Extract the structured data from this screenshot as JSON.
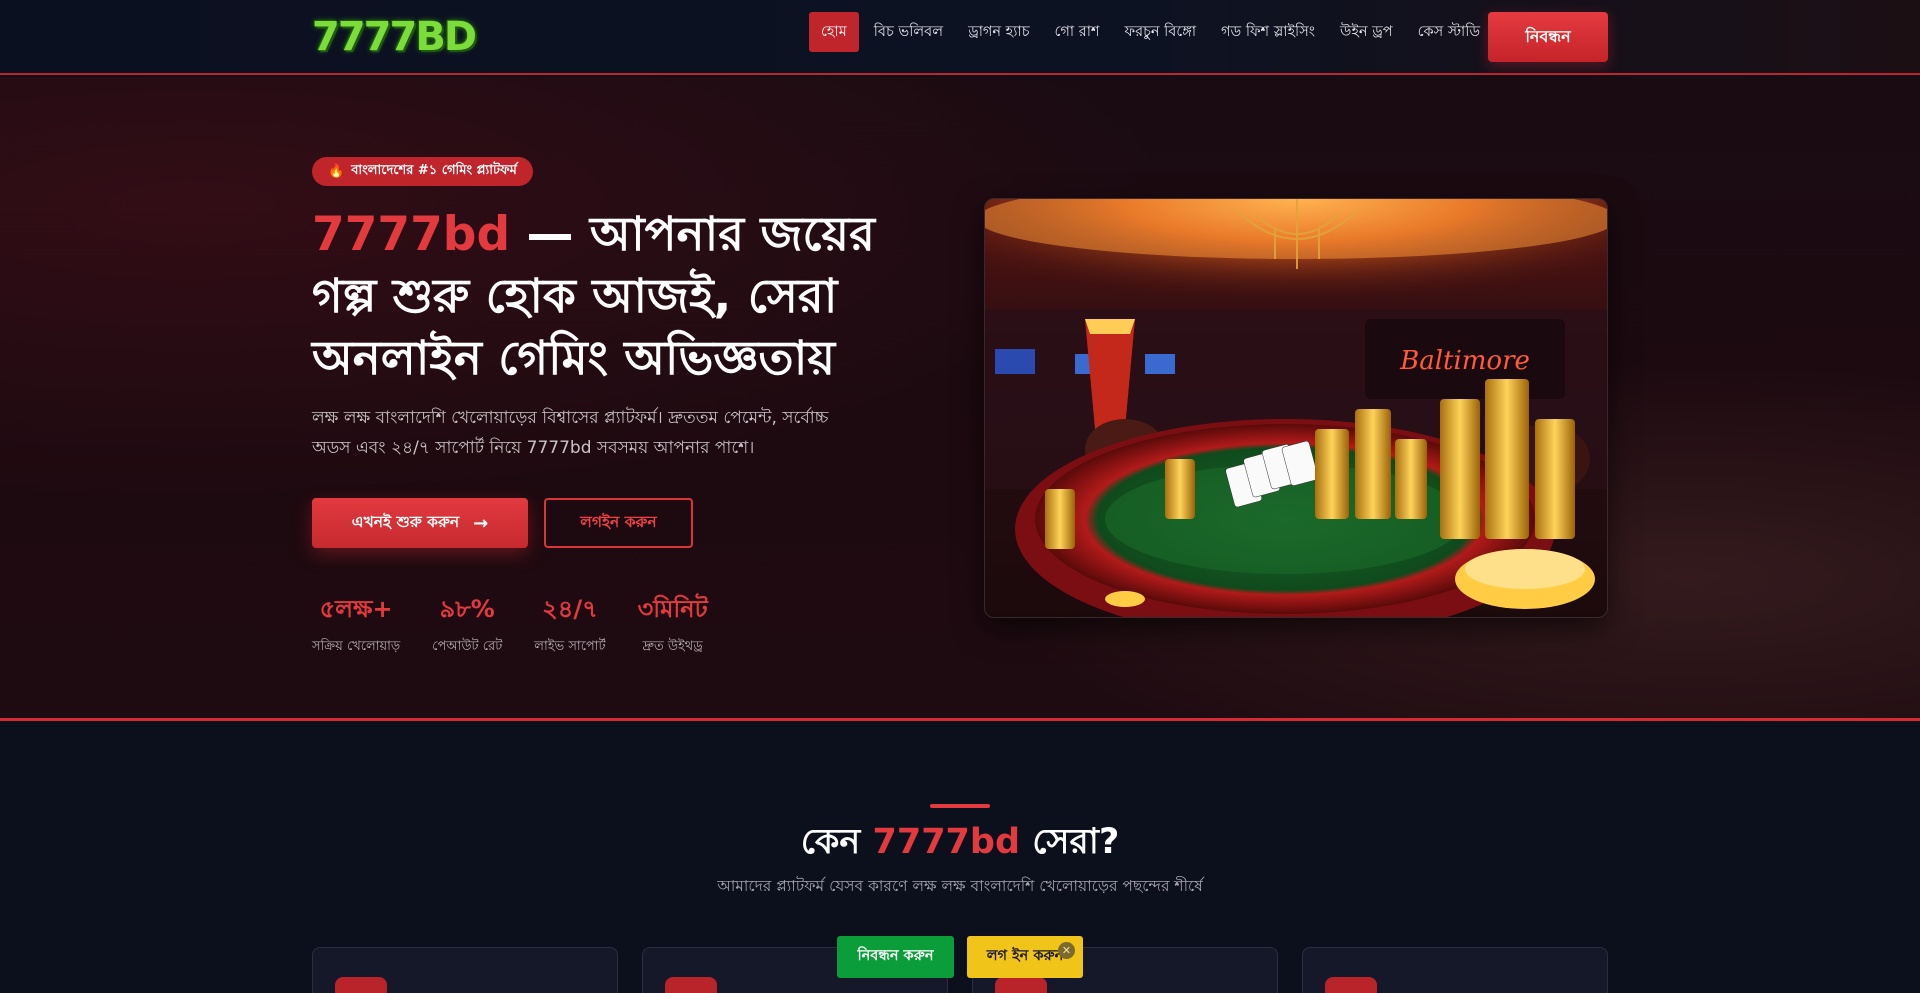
{
  "header": {
    "logo_text": "7777BD",
    "nav": [
      {
        "label": "হোম",
        "active": true
      },
      {
        "label": "বিচ ভলিবল",
        "active": false
      },
      {
        "label": "ড্রাগন হ্যাচ",
        "active": false
      },
      {
        "label": "গো রাশ",
        "active": false
      },
      {
        "label": "ফরচুন বিঙ্গো",
        "active": false
      },
      {
        "label": "গড ফিশ স্লাইসিং",
        "active": false
      },
      {
        "label": "উইন ড্রপ",
        "active": false
      },
      {
        "label": "কেস স্টাডি",
        "active": false
      }
    ],
    "register_label": "নিবন্ধন"
  },
  "hero": {
    "badge_icon": "fire-icon",
    "badge_text": "বাংলাদেশের #১ গেমিং প্ল্যাটফর্ম",
    "title_brand": "7777bd",
    "title_rest": " — আপনার জয়ের গল্প শুরু হোক আজই, সেরা অনলাইন গেমিং অভিজ্ঞতায়",
    "description": "লক্ষ লক্ষ বাংলাদেশি খেলোয়াড়ের বিশ্বাসের প্ল্যাটফর্ম। দ্রুততম পেমেন্ট, সর্বোচ্চ অডস এবং ২৪/৭ সাপোর্ট নিয়ে 7777bd সবসময় আপনার পাশে।",
    "cta_primary": "এখনই শুরু করুন",
    "cta_primary_icon": "arrow-right-icon",
    "cta_secondary": "লগইন করুন",
    "stats": [
      {
        "value": "৫লক্ষ+",
        "label": "সক্রিয় খেলোয়াড়"
      },
      {
        "value": "৯৮%",
        "label": "পেআউট রেট"
      },
      {
        "value": "২৪/৭",
        "label": "লাইভ সাপোর্ট"
      },
      {
        "value": "৩মিনিট",
        "label": "দ্রুত উইথড্র"
      }
    ],
    "image_sign_text": "Baltimore"
  },
  "why_section": {
    "title_prefix": "কেন ",
    "title_brand": "7777bd",
    "title_suffix": " সেরা?",
    "subtitle": "আমাদের প্ল্যাটফর্ম যেসব কারণে লক্ষ লক্ষ বাংলাদেশি খেলোয়াড়ের পছন্দের শীর্ষে"
  },
  "floating_bar": {
    "register_label": "নিবন্ধন করুন",
    "login_label": "লগ ইন করুন",
    "close_icon": "close-icon",
    "close_glyph": "✕"
  },
  "colors": {
    "accent": "#e23a3f",
    "register_green": "#0a9d3a",
    "login_yellow": "#f0c419",
    "background": "#0c0f1c"
  }
}
